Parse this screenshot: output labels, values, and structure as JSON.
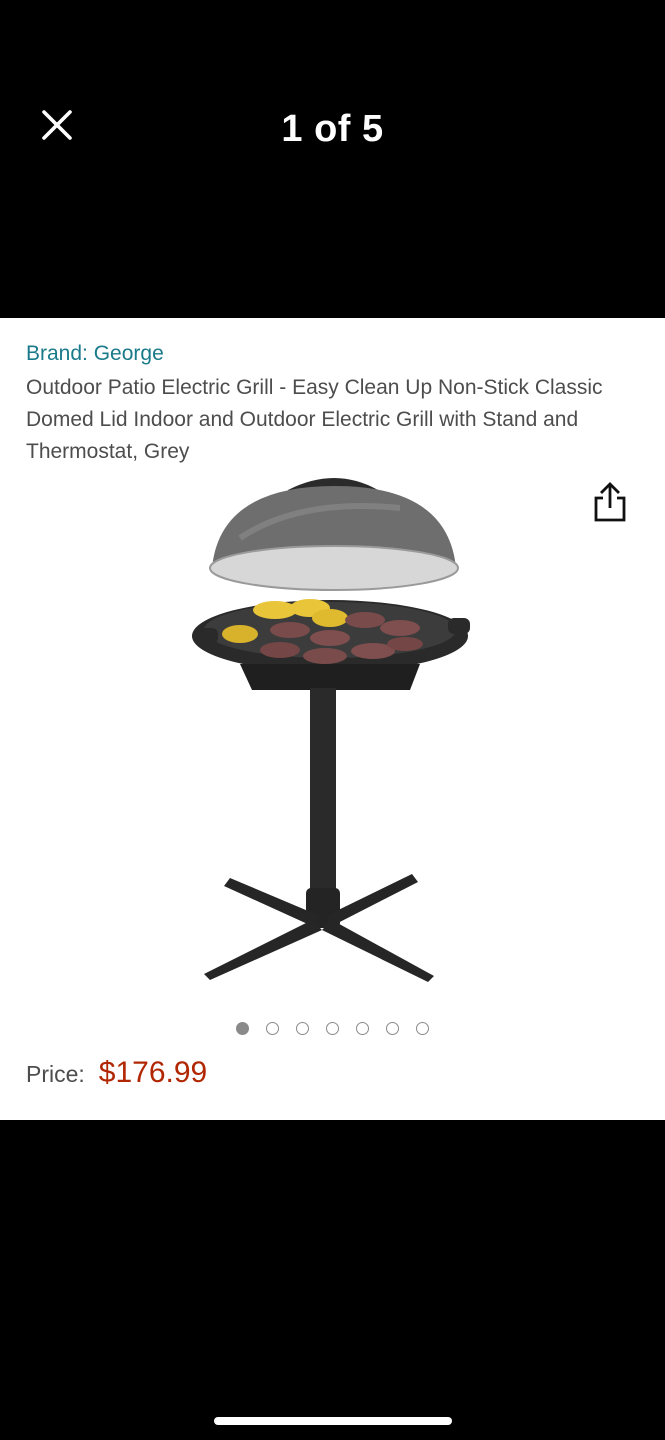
{
  "header": {
    "counter": "1 of 5",
    "close_icon": "close-icon"
  },
  "product": {
    "brand": "Brand: George",
    "title": "Outdoor Patio Electric Grill - Easy Clean Up Non-Stick Classic Domed Lid Indoor and Outdoor Electric Grill with Stand and Thermostat, Grey",
    "share_icon": "share-icon",
    "image": "grill-image"
  },
  "carousel": {
    "total_dots": 7,
    "active_index": 0
  },
  "pricing": {
    "label": "Price:",
    "value": "$176.99",
    "color": "#b12704"
  },
  "colors": {
    "brand_link": "#1a7a8a",
    "background": "#000000",
    "card": "#ffffff"
  }
}
